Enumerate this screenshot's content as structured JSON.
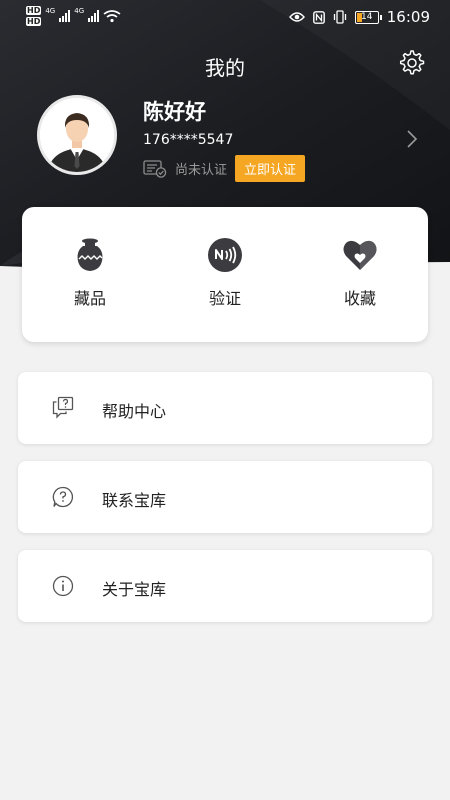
{
  "status_bar": {
    "left_badges": [
      "HD",
      "HD"
    ],
    "network": [
      "4G",
      "4G"
    ],
    "battery": "14",
    "time": "16:09"
  },
  "header": {
    "title": "我的",
    "settings_icon": "gear-icon"
  },
  "profile": {
    "name": "陈好好",
    "phone": "176****5547",
    "verify_status": "尚未认证",
    "verify_button": "立即认证"
  },
  "quick_actions": [
    {
      "label": "藏品",
      "icon": "vase-icon"
    },
    {
      "label": "验证",
      "icon": "nfc-icon"
    },
    {
      "label": "收藏",
      "icon": "heart-icon"
    }
  ],
  "menu": [
    {
      "label": "帮助中心",
      "icon": "help-center-icon"
    },
    {
      "label": "联系宝库",
      "icon": "contact-icon"
    },
    {
      "label": "关于宝库",
      "icon": "info-icon"
    }
  ],
  "colors": {
    "header_dark": "#1c1e22",
    "accent": "#f5a623",
    "background": "#f2f2f2"
  }
}
